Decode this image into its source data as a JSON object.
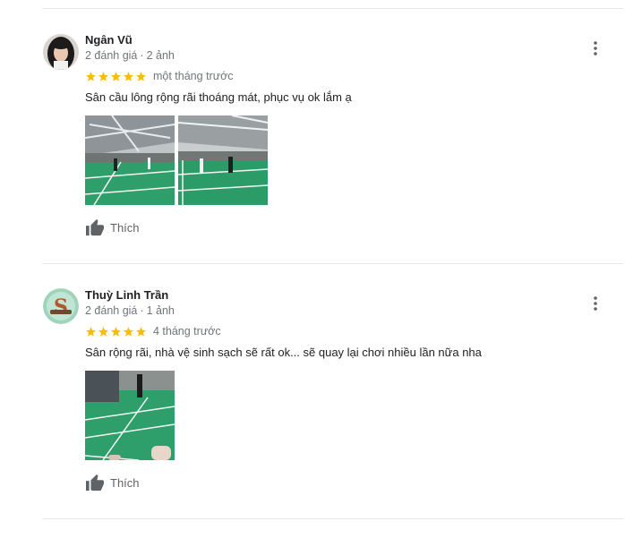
{
  "reviews": [
    {
      "author": "Ngân Vũ",
      "review_count": "2 đánh giá",
      "separator": "·",
      "photo_count": "2 ảnh",
      "stars": 5,
      "date": "một tháng trước",
      "text": "Sân cầu lông rộng rãi thoáng mát, phục vụ ok lắm ạ",
      "like_label": "Thích",
      "more_icon": "more-vert-icon"
    },
    {
      "author": "Thuỳ Linh Trần",
      "review_count": "2 đánh giá",
      "separator": "·",
      "photo_count": "1 ảnh",
      "stars": 5,
      "date": "4 tháng trước",
      "text": "Sân rộng rãi, nhà vệ sinh sạch sẽ rất ok... sẽ quay lại chơi nhiều lần nữa nha",
      "like_label": "Thích",
      "more_icon": "more-vert-icon"
    }
  ],
  "colors": {
    "star": "#fbbc04",
    "meta": "#70757a",
    "like": "#5f6368",
    "court_green": "#2e9e6a"
  }
}
